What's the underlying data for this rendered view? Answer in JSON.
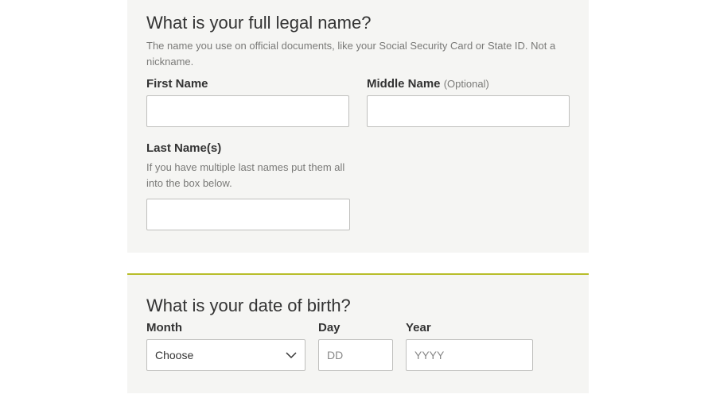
{
  "name_section": {
    "title": "What is your full legal name?",
    "hint": "The name you use on official documents, like your Social Security Card or State ID. Not a nickname.",
    "first_name": {
      "label": "First Name",
      "value": ""
    },
    "middle_name": {
      "label": "Middle Name",
      "optional": "(Optional)",
      "value": ""
    },
    "last_name": {
      "label": "Last Name(s)",
      "hint": "If you have multiple last names put them all into the box below.",
      "value": ""
    }
  },
  "dob_section": {
    "title": "What is your date of birth?",
    "month": {
      "label": "Month",
      "selected": "Choose"
    },
    "day": {
      "label": "Day",
      "placeholder": "DD",
      "value": ""
    },
    "year": {
      "label": "Year",
      "placeholder": "YYYY",
      "value": ""
    }
  }
}
